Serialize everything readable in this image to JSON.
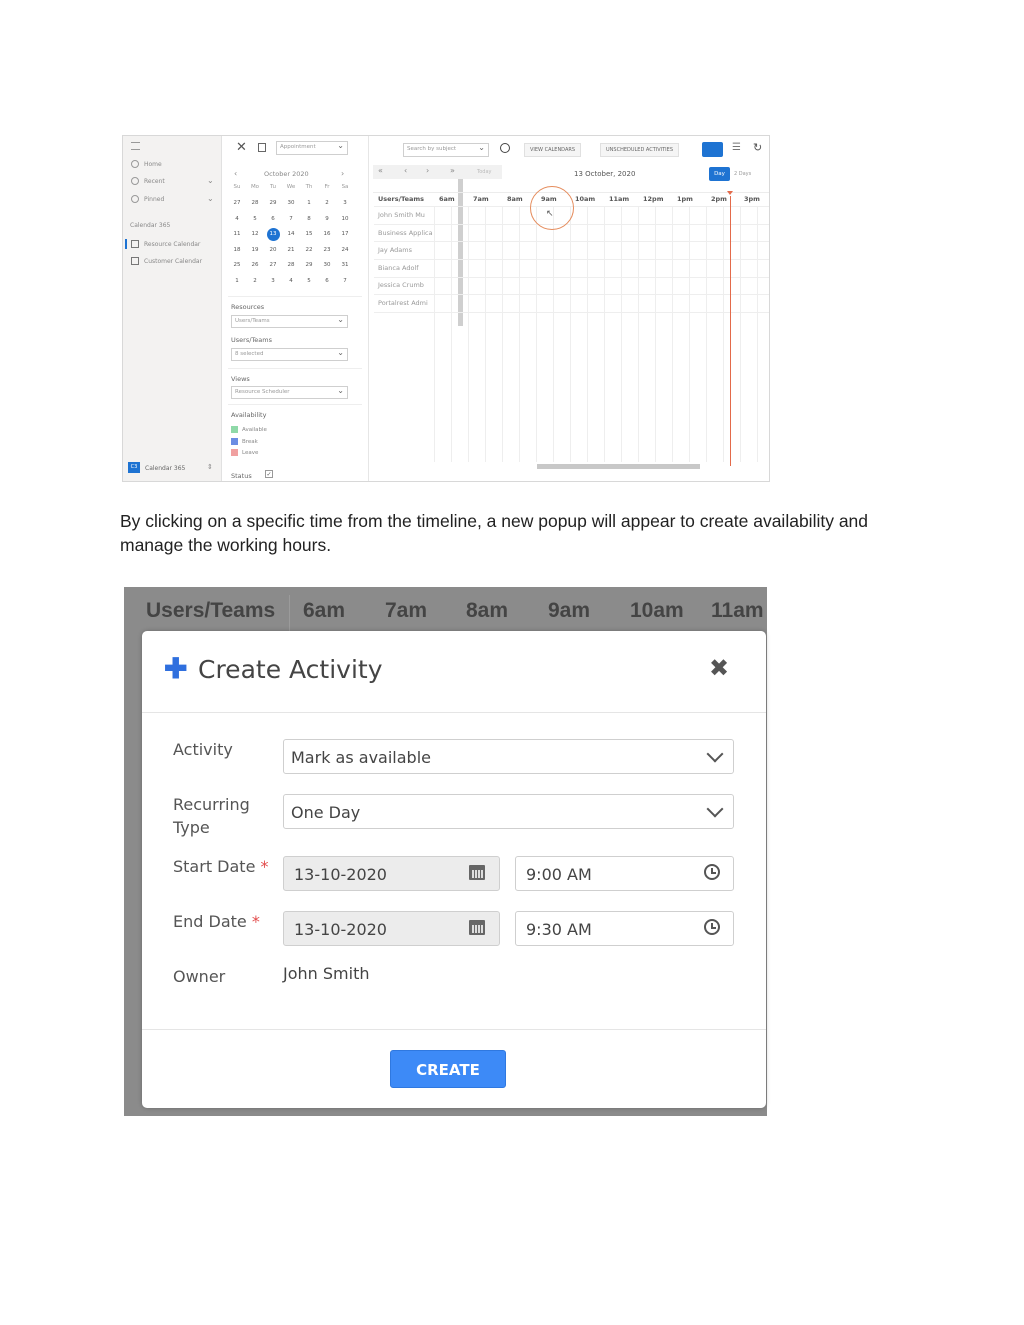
{
  "screenshot1": {
    "nav": {
      "menu_icon": "hamburger-icon",
      "items": [
        {
          "label": "Home",
          "icon": "home-icon"
        },
        {
          "label": "Recent",
          "icon": "clock-icon"
        },
        {
          "label": "Pinned",
          "icon": "pin-icon"
        }
      ],
      "section": "Calendar 365",
      "apps": [
        {
          "label": "Resource Calendar",
          "icon": "calendar-icon"
        },
        {
          "label": "Customer Calendar",
          "icon": "calendar-icon"
        }
      ],
      "footer_badge": "C3",
      "footer_label": "Calendar 365"
    },
    "toolbar": {
      "entity_select": "Appointment",
      "search_placeholder": "Search by subject",
      "view_calendars": "VIEW CALENDARS",
      "unscheduled": "UNSCHEDULED ACTIVITIES"
    },
    "mini_calendar": {
      "month": "October 2020",
      "dows": [
        "Su",
        "Mo",
        "Tu",
        "We",
        "Th",
        "Fr",
        "Sa"
      ],
      "weeks": [
        [
          "27",
          "28",
          "29",
          "30",
          "1",
          "2",
          "3"
        ],
        [
          "4",
          "5",
          "6",
          "7",
          "8",
          "9",
          "10"
        ],
        [
          "11",
          "12",
          "13",
          "14",
          "15",
          "16",
          "17"
        ],
        [
          "18",
          "19",
          "20",
          "21",
          "22",
          "23",
          "24"
        ],
        [
          "25",
          "26",
          "27",
          "28",
          "29",
          "30",
          "31"
        ],
        [
          "1",
          "2",
          "3",
          "4",
          "5",
          "6",
          "7"
        ]
      ],
      "selected": "13"
    },
    "filters": {
      "resources_label": "Resources",
      "resources_value": "Users/Teams",
      "users_label": "Users/Teams",
      "users_value": "8 selected",
      "views_label": "Views",
      "views_value": "Resource Scheduler",
      "availability_label": "Availability",
      "legend": [
        {
          "label": "Available",
          "color": "#8fd9a8"
        },
        {
          "label": "Break",
          "color": "#6b8de3"
        },
        {
          "label": "Leave",
          "color": "#f0a0a0"
        }
      ],
      "status_label": "Status"
    },
    "scheduler": {
      "today_label": "Today",
      "date_title": "13 October, 2020",
      "day_btn": "Day",
      "two_days_btn": "2 Days",
      "column_header": "Users/Teams",
      "hours": [
        "6am",
        "7am",
        "8am",
        "9am",
        "10am",
        "11am",
        "12pm",
        "1pm",
        "2pm",
        "3pm"
      ],
      "users": [
        "John Smith Mu",
        "Business Applica",
        "Jay Adams",
        "Bianca Adolf",
        "Jessica Crumb",
        "Portalrest Admi"
      ]
    }
  },
  "caption": "By clicking on a specific time from the timeline, a new popup will appear to create availability and manage the working hours.",
  "screenshot2": {
    "background_header": {
      "column": "Users/Teams",
      "hours": [
        "6am",
        "7am",
        "8am",
        "9am",
        "10am",
        "11am"
      ]
    },
    "modal": {
      "title": "Create Activity",
      "activity_label": "Activity",
      "activity_value": "Mark as available",
      "recurring_label_line1": "Recurring",
      "recurring_label_line2": "Type",
      "recurring_value": "One Day",
      "start_date_label": "Start Date",
      "start_date": "13-10-2020",
      "start_time": "9:00 AM",
      "end_date_label": "End Date",
      "end_date": "13-10-2020",
      "end_time": "9:30 AM",
      "required_mark": "*",
      "owner_label": "Owner",
      "owner_value": "John Smith",
      "create_button": "CREATE"
    }
  }
}
